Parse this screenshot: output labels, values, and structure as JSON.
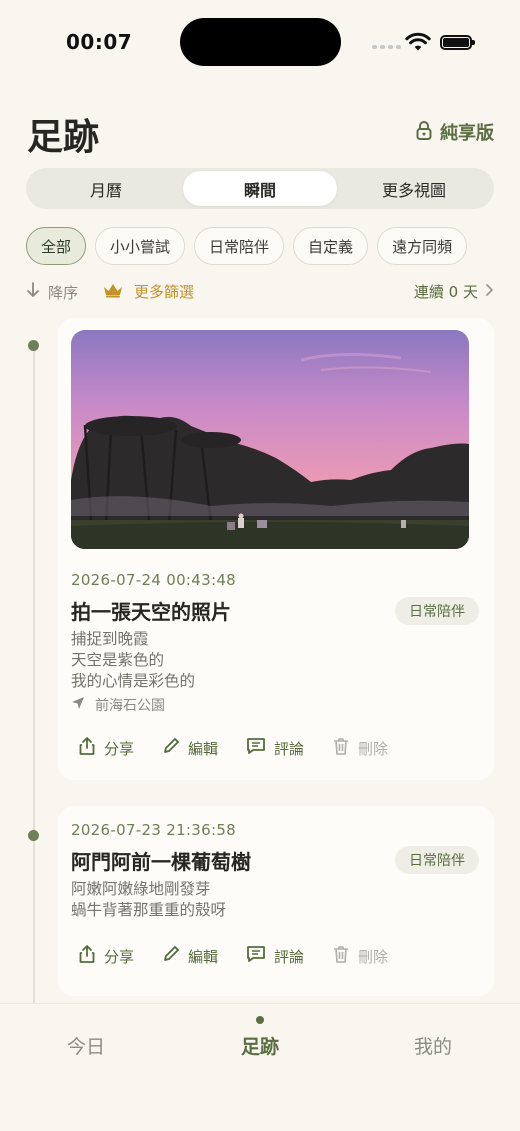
{
  "status": {
    "time": "00:07"
  },
  "header": {
    "title": "足跡",
    "premium_label": "純享版"
  },
  "tabs": [
    {
      "label": "月曆",
      "active": false
    },
    {
      "label": "瞬間",
      "active": true
    },
    {
      "label": "更多視圖",
      "active": false
    }
  ],
  "filters": [
    {
      "label": "全部",
      "active": true
    },
    {
      "label": "小小嘗試",
      "active": false
    },
    {
      "label": "日常陪伴",
      "active": false
    },
    {
      "label": "自定義",
      "active": false
    },
    {
      "label": "遠方同頻",
      "active": false
    }
  ],
  "toolbar": {
    "sort_label": "降序",
    "more_filter_label": "更多篩選",
    "streak_label": "連續 0 天"
  },
  "entries": [
    {
      "timestamp": "2026-07-24 00:43:48",
      "title": "拍一張天空的照片",
      "tag": "日常陪伴",
      "lines": [
        "捕捉到晚霞",
        "天空是紫色的",
        "我的心情是彩色的"
      ],
      "location": "前海石公園",
      "has_photo": true
    },
    {
      "timestamp": "2026-07-23 21:36:58",
      "title": "阿門阿前一棵葡萄樹",
      "tag": "日常陪伴",
      "lines": [
        "阿嫩阿嫩綠地剛發芽",
        "蝸牛背著那重重的殼呀"
      ],
      "has_photo": false
    }
  ],
  "actions": {
    "share": "分享",
    "edit": "編輯",
    "comment": "評論",
    "delete": "刪除"
  },
  "nav": [
    {
      "label": "今日",
      "active": false
    },
    {
      "label": "足跡",
      "active": true
    },
    {
      "label": "我的",
      "active": false
    }
  ],
  "colors": {
    "accent": "#5b6d43",
    "gold": "#c4922a",
    "background": "#f8f6ee"
  }
}
